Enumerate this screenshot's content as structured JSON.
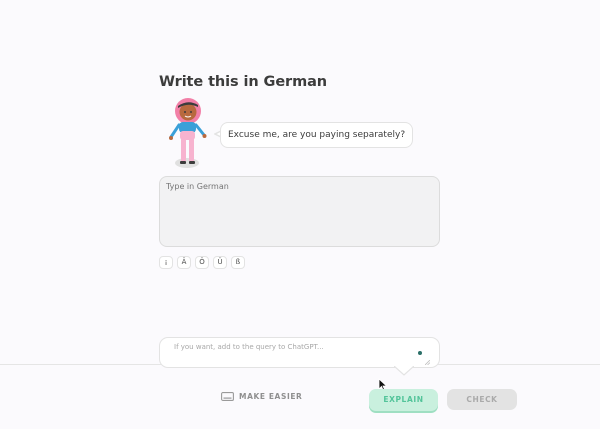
{
  "exercise": {
    "title": "Write this in German",
    "prompt": "Excuse me, are you paying separately?"
  },
  "answer": {
    "placeholder": "Type in German",
    "value": ""
  },
  "special_chars": [
    "¡",
    "Ä",
    "Ö",
    "Ü",
    "ß"
  ],
  "assistant": {
    "placeholder": "If you want, add to the query to ChatGPT..."
  },
  "footer": {
    "make_easier_label": "MAKE EASIER",
    "explain_label": "EXPLAIN",
    "check_label": "CHECK"
  },
  "icons": {
    "make_easier": "keyboard-icon",
    "character": "character-illustration",
    "status_dot": "status-dot-icon",
    "resize": "resize-handle-icon"
  },
  "colors": {
    "explain_bg": "#c9f0de",
    "explain_text": "#53c49a",
    "check_bg": "#e3e3e3",
    "character_hijab": "#f27fa7",
    "character_shirt": "#3aa0d8"
  }
}
